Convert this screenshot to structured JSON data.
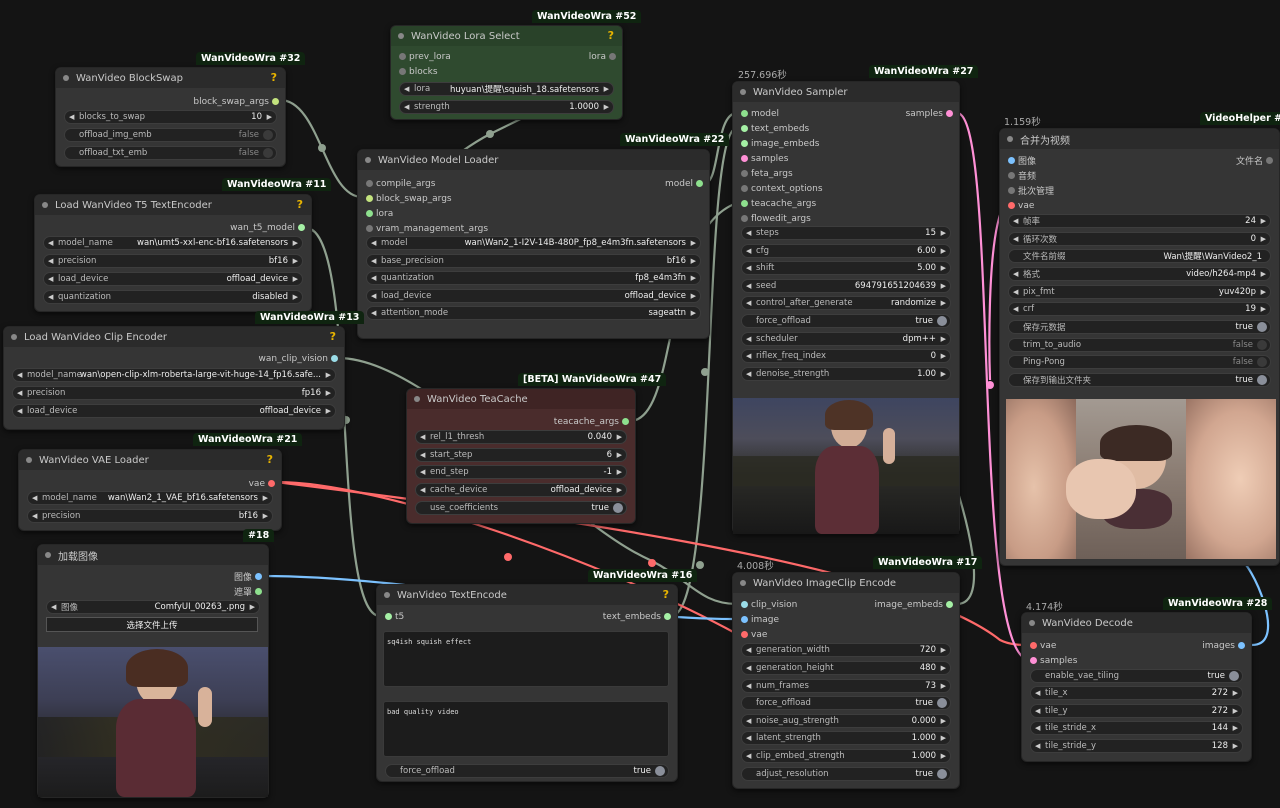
{
  "nodes": {
    "blockswap": {
      "badge": "WanVideoWra #32",
      "title": "WanVideo BlockSwap",
      "out": "block_swap_args",
      "blocks_label": "blocks_to_swap",
      "blocks_value": "10",
      "img_label": "offload_img_emb",
      "img_value": "false",
      "txt_label": "offload_txt_emb",
      "txt_value": "false"
    },
    "lora": {
      "badge": "WanVideoWra #52",
      "title": "WanVideo Lora Select",
      "in1": "prev_lora",
      "in2": "blocks",
      "out": "lora",
      "lora_label": "lora",
      "lora_value": "huyuan\\提醒\\squish_18.safetensors",
      "strength_label": "strength",
      "strength_value": "1.0000"
    },
    "t5": {
      "badge": "WanVideoWra #11",
      "title": "Load WanVideo T5 TextEncoder",
      "out": "wan_t5_model",
      "model_label": "model_name",
      "model_value": "wan\\umt5-xxl-enc-bf16.safetensors",
      "prec_label": "precision",
      "prec_value": "bf16",
      "dev_label": "load_device",
      "dev_value": "offload_device",
      "q_label": "quantization",
      "q_value": "disabled"
    },
    "clipenc": {
      "badge": "WanVideoWra #13",
      "title": "Load WanVideo Clip Encoder",
      "out": "wan_clip_vision",
      "model_label": "model_name",
      "model_value": "wan\\open-clip-xlm-roberta-large-vit-huge-14_fp16.safe...",
      "prec_label": "precision",
      "prec_value": "fp16",
      "dev_label": "load_device",
      "dev_value": "offload_device"
    },
    "vae": {
      "badge": "WanVideoWra #21",
      "title": "WanVideo VAE Loader",
      "out": "vae",
      "model_label": "model_name",
      "model_value": "wan\\Wan2_1_VAE_bf16.safetensors",
      "prec_label": "precision",
      "prec_value": "bf16"
    },
    "loadimg": {
      "badge": "#18",
      "title": "加载图像",
      "out1": "图像",
      "out2": "遮罩",
      "img_label": "图像",
      "img_value": "ComfyUI_00263_.png",
      "upload": "选择文件上传"
    },
    "model": {
      "badge": "WanVideoWra #22",
      "title": "WanVideo Model Loader",
      "in1": "compile_args",
      "in2": "block_swap_args",
      "in3": "lora",
      "in4": "vram_management_args",
      "out": "model",
      "model_label": "model",
      "model_value": "wan\\Wan2_1-I2V-14B-480P_fp8_e4m3fn.safetensors",
      "bp_label": "base_precision",
      "bp_value": "bf16",
      "q_label": "quantization",
      "q_value": "fp8_e4m3fn",
      "dev_label": "load_device",
      "dev_value": "offload_device",
      "att_label": "attention_mode",
      "att_value": "sageattn"
    },
    "teacache": {
      "badge": "[BETA] WanVideoWra #47",
      "title": "WanVideo TeaCache",
      "out": "teacache_args",
      "r_label": "rel_l1_thresh",
      "r_value": "0.040",
      "s_label": "start_step",
      "s_value": "6",
      "e_label": "end_step",
      "e_value": "-1",
      "d_label": "cache_device",
      "d_value": "offload_device",
      "u_label": "use_coefficients",
      "u_value": "true"
    },
    "textenc": {
      "badge": "WanVideoWra #16",
      "title": "WanVideo TextEncode",
      "in1": "t5",
      "out": "text_embeds",
      "pos": "sq4ish squish effect",
      "neg": "bad quality video",
      "fo_label": "force_offload",
      "fo_value": "true"
    },
    "sampler": {
      "timer": "257.696秒",
      "badge": "WanVideoWra #27",
      "title": "WanVideo Sampler",
      "in": [
        "model",
        "text_embeds",
        "image_embeds",
        "samples",
        "feta_args",
        "context_options",
        "teacache_args",
        "flowedit_args"
      ],
      "out": "samples",
      "w": [
        [
          "steps",
          "15"
        ],
        [
          "cfg",
          "6.00"
        ],
        [
          "shift",
          "5.00"
        ],
        [
          "seed",
          "694791651204639"
        ],
        [
          "control_after_generate",
          "randomize"
        ]
      ],
      "fo_label": "force_offload",
      "fo_value": "true",
      "w2": [
        [
          "scheduler",
          "dpm++"
        ],
        [
          "riflex_freq_index",
          "0"
        ],
        [
          "denoise_strength",
          "1.00"
        ]
      ]
    },
    "imgclip": {
      "timer": "4.008秒",
      "badge": "WanVideoWra #17",
      "title": "WanVideo ImageClip Encode",
      "in": [
        "clip_vision",
        "image",
        "vae"
      ],
      "out": "image_embeds",
      "w": [
        [
          "generation_width",
          "720"
        ],
        [
          "generation_height",
          "480"
        ],
        [
          "num_frames",
          "73"
        ]
      ],
      "fo_label": "force_offload",
      "fo_value": "true",
      "w2": [
        [
          "noise_aug_strength",
          "0.000"
        ],
        [
          "latent_strength",
          "1.000"
        ],
        [
          "clip_embed_strength",
          "1.000"
        ]
      ],
      "adj_label": "adjust_resolution",
      "adj_value": "true"
    },
    "combine": {
      "timer": "1.159秒",
      "badge": "VideoHelper #30",
      "title": "合并为视频",
      "in": [
        "图像",
        "音频",
        "批次管理",
        "vae"
      ],
      "out": "文件名",
      "w": [
        [
          "帧率",
          "24"
        ],
        [
          "循环次数",
          "0"
        ],
        [
          "文件名前缀",
          "Wan\\提醒\\WanVideo2_1"
        ],
        [
          "格式",
          "video/h264-mp4"
        ],
        [
          "pix_fmt",
          "yuv420p"
        ],
        [
          "crf",
          "19"
        ]
      ],
      "t": [
        [
          "保存元数据",
          "true"
        ],
        [
          "trim_to_audio",
          "false"
        ],
        [
          "Ping-Pong",
          "false"
        ],
        [
          "保存到输出文件夹",
          "true"
        ]
      ]
    },
    "decode": {
      "timer": "4.174秒",
      "badge": "WanVideoWra #28",
      "title": "WanVideo Decode",
      "in": [
        "vae",
        "samples"
      ],
      "out": "images",
      "evt_label": "enable_vae_tiling",
      "evt_value": "true",
      "w": [
        [
          "tile_x",
          "272"
        ],
        [
          "tile_y",
          "272"
        ],
        [
          "tile_stride_x",
          "144"
        ],
        [
          "tile_stride_y",
          "128"
        ]
      ]
    }
  },
  "colors": {
    "lora_node": "#2f4a2f",
    "teacache_node": "#4a2c2c",
    "link_grey": "#8fa08f",
    "link_red": "#ff6a6a",
    "link_blue": "#7cc2ff",
    "link_pink": "#ff90d6"
  }
}
